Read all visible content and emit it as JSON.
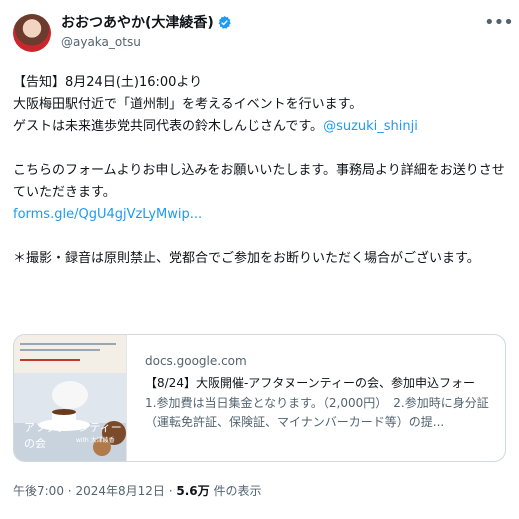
{
  "author": {
    "display_name": "おおつあやか(大津綾香)",
    "handle": "@ayaka_otsu",
    "avatar_icon": "profile-photo",
    "verified_icon": "verified-badge-icon",
    "more_icon": "more-icon"
  },
  "tweet": {
    "line1": "【告知】8月24日(土)16:00より",
    "line2": "大阪梅田駅付近で「道州制」を考えるイベントを行います。",
    "line3": "ゲストは未来進歩党共同代表の鈴木しんじさんです。",
    "mention": "@suzuki_shinji",
    "line4": "こちらのフォームよりお申し込みをお願いいたします。事務局より詳細をお送りさせていただきます。",
    "link": "forms.gle/QgU4gjVzLyMwip...",
    "line5": "＊撮影・録音は原則禁止、党都合でご参加をお断りいただく場合がございます。"
  },
  "card": {
    "domain": "docs.google.com",
    "title": "【8/24】大阪開催-アフタヌーンティーの会、参加申込フォー",
    "description": "1.参加費は当日集金となります。（2,000円）　2.参加時に身分証（運転免許証、保険証、マイナンバーカード等）の提...",
    "thumb_title": "アフタヌーンティーの会",
    "thumb_sub": "with 大津綾香"
  },
  "meta": {
    "time": "午後7:00",
    "separator": "·",
    "date": "2024年8月12日",
    "views_count": "5.6万",
    "views_label": "件の表示"
  },
  "colors": {
    "link": "#1d9bf0",
    "verified": "#1d9bf0"
  }
}
